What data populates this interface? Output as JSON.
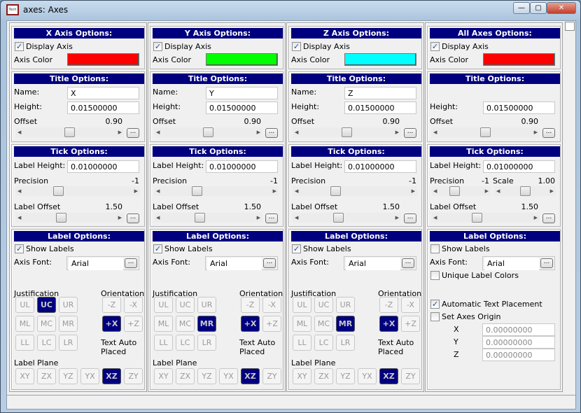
{
  "window": {
    "title": "axes: Axes",
    "app_icon": "Tech",
    "controls": {
      "minimize": "—",
      "maximize": "▢",
      "close": "✕"
    }
  },
  "labels": {
    "display_axis": "Display Axis",
    "axis_color": "Axis Color",
    "title_options": "Title Options:",
    "name": "Name:",
    "height": "Height:",
    "offset": "Offset",
    "tick_options": "Tick Options:",
    "label_height": "Label Height:",
    "precision": "Precision",
    "scale": "Scale",
    "label_offset": "Label Offset",
    "label_options": "Label Options:",
    "show_labels": "Show Labels",
    "axis_font": "Axis Font:",
    "justification": "Justification",
    "orientation": "Orientation",
    "text_auto_1": "Text Auto",
    "text_auto_2": "Placed",
    "label_plane": "Label Plane",
    "unique_label_colors": "Unique Label Colors",
    "automatic_text_placement": "Automatic Text Placement",
    "set_axes_origin": "Set Axes Origin",
    "ellipsis": "...",
    "x": "X",
    "y": "Y",
    "z": "Z"
  },
  "justification_buttons": [
    "UL",
    "UC",
    "UR",
    "ML",
    "MC",
    "MR",
    "LL",
    "LC",
    "LR"
  ],
  "orientation_buttons": [
    "-Z",
    "-X",
    "+X",
    "+Z"
  ],
  "plane_buttons": [
    "XY",
    "ZX",
    "YZ",
    "YX",
    "XZ",
    "ZY"
  ],
  "columns": [
    {
      "id": "x",
      "title": "X Axis Options:",
      "display_axis": true,
      "axis_color": "#ff0000",
      "name": "X",
      "height": "0.01500000",
      "offset": "0.90",
      "offset_level": 0.5,
      "label_height": "0.01000000",
      "precision": "-1",
      "precision_level": 0.3,
      "label_offset": "1.50",
      "label_offset_level": 0.4,
      "show_labels": true,
      "font": "Arial",
      "justification": "UC",
      "orientation": "+X",
      "plane": "XZ"
    },
    {
      "id": "y",
      "title": "Y Axis Options:",
      "display_axis": true,
      "axis_color": "#00ff00",
      "name": "Y",
      "height": "0.01500000",
      "offset": "0.90",
      "offset_level": 0.5,
      "label_height": "0.01000000",
      "precision": "-1",
      "precision_level": 0.3,
      "label_offset": "1.50",
      "label_offset_level": 0.4,
      "show_labels": true,
      "font": "Arial",
      "justification": "MR",
      "orientation": "+X",
      "plane": "XZ"
    },
    {
      "id": "z",
      "title": "Z Axis Options:",
      "display_axis": true,
      "axis_color": "#00ffff",
      "name": "Z",
      "height": "0.01500000",
      "offset": "0.90",
      "offset_level": 0.5,
      "label_height": "0.01000000",
      "precision": "-1",
      "precision_level": 0.3,
      "label_offset": "1.50",
      "label_offset_level": 0.4,
      "show_labels": true,
      "font": "Arial",
      "justification": "MR",
      "orientation": "+X",
      "plane": "XZ"
    },
    {
      "id": "all",
      "title": "All Axes Options:",
      "display_axis": true,
      "axis_color": "#ff0000",
      "height": "0.01500000",
      "offset": "0.90",
      "offset_level": 0.5,
      "label_height": "0.01000000",
      "precision": "-1",
      "precision_level": 0.3,
      "scale": "1.00",
      "scale_level": 0.5,
      "label_offset": "1.50",
      "label_offset_level": 0.4,
      "show_labels": false,
      "font": "Arial",
      "unique_label_colors": false,
      "automatic_text_placement": true,
      "set_axes_origin": false,
      "origin": {
        "x": "0.00000000",
        "y": "0.00000000",
        "z": "0.00000000"
      }
    }
  ]
}
